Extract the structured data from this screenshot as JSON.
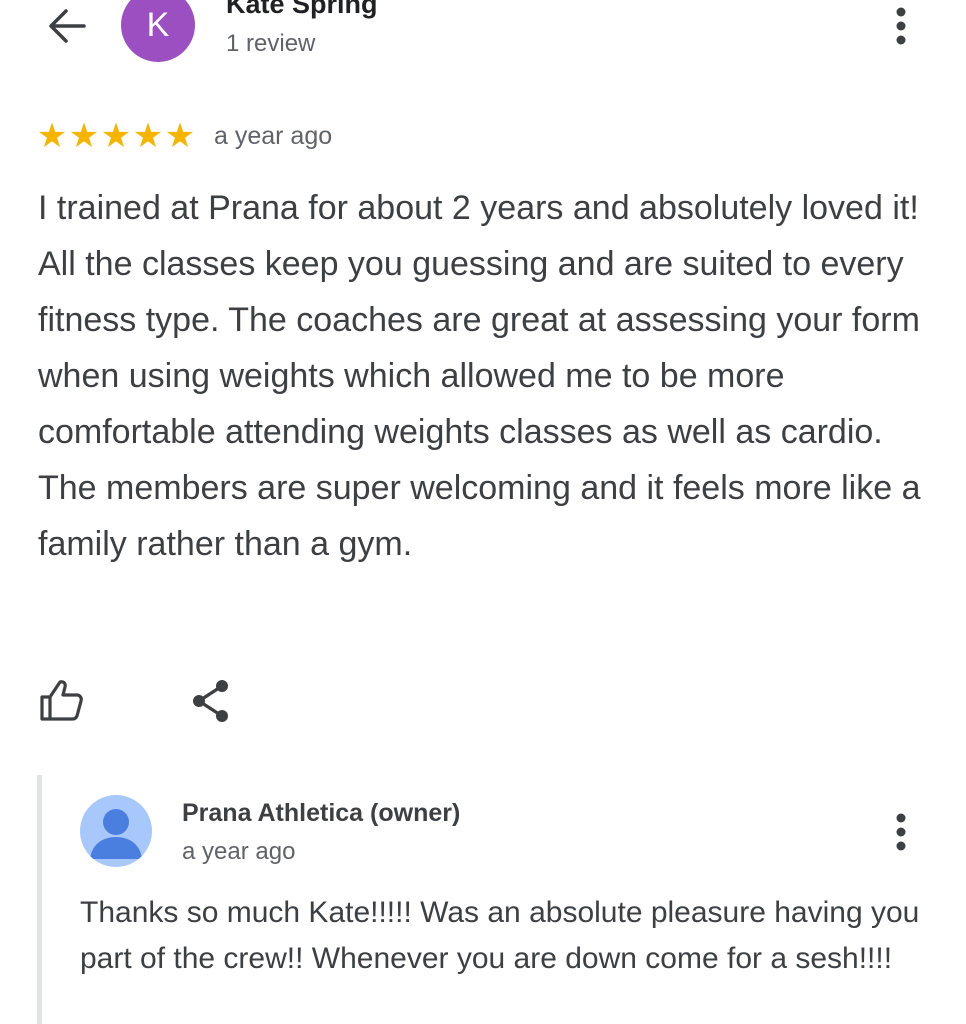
{
  "header": {
    "avatar_letter": "K",
    "avatar_color": "#9c4fc0",
    "reviewer_name": "Kate Spring",
    "review_count": "1 review",
    "back_icon": "arrow-back-icon",
    "more_icon": "more-vert-icon"
  },
  "review": {
    "rating": 5,
    "max_rating": 5,
    "star_color": "#f4b400",
    "time": "a year ago",
    "text": "I trained at Prana for about 2 years and absolutely loved it! All the classes keep you guessing and are suited to every fitness type. The coaches are great at assessing your form when using weights which allowed me to be more comfortable attending weights classes as well as cardio. The members are super welcoming and it feels more like a family rather than a gym."
  },
  "actions": {
    "like_icon": "thumb-up-icon",
    "share_icon": "share-icon"
  },
  "owner_reply": {
    "name": "Prana Athletica (owner)",
    "time": "a year ago",
    "avatar_icon": "default-person-avatar-icon",
    "avatar_bg": "#a8c7fa",
    "avatar_fg": "#4a7fe0",
    "more_icon": "more-vert-icon",
    "text": "Thanks so much Kate!!!!! Was an absolute pleasure having you part of the crew!! Whenever you are down come for a sesh!!!!"
  }
}
